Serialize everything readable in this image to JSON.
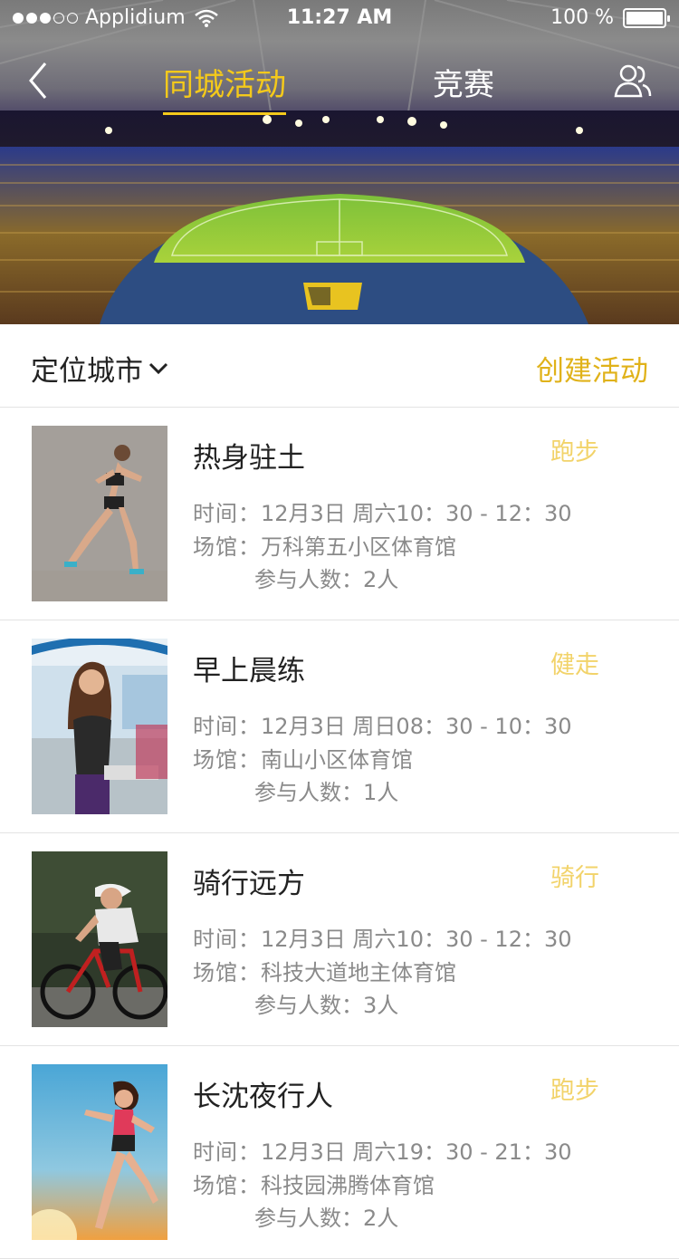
{
  "status_bar": {
    "carrier": "Applidium",
    "time": "11:27 AM",
    "battery": "100 %"
  },
  "nav": {
    "tabs": [
      "同城活动",
      "竞赛"
    ],
    "active_tab": 0
  },
  "filter": {
    "city_label": "定位城市",
    "create_label": "创建活动"
  },
  "labels": {
    "time": "时间：",
    "venue": "场馆：",
    "participants": "参与人数："
  },
  "activities": [
    {
      "title": "热身驻土",
      "tag": "跑步",
      "time": "12月3日  周六10：30 - 12：30",
      "venue": "万科第五小区体育馆",
      "participants": "2人"
    },
    {
      "title": "早上晨练",
      "tag": "健走",
      "time": "12月3日  周日08：30 - 10：30",
      "venue": "南山小区体育馆",
      "participants": "1人"
    },
    {
      "title": "骑行远方",
      "tag": "骑行",
      "time": "12月3日  周六10：30 - 12：30",
      "venue": "科技大道地主体育馆",
      "participants": "3人"
    },
    {
      "title": "长沈夜行人",
      "tag": "跑步",
      "time": "12月3日  周六19：30 - 21：30",
      "venue": "科技园沸腾体育馆",
      "participants": "2人"
    }
  ],
  "colors": {
    "accent": "#f4c91b",
    "tag": "#f2d36a",
    "secondary_text": "#8a8a8a"
  }
}
